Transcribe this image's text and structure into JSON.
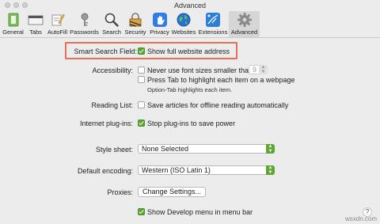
{
  "window": {
    "title": "Advanced"
  },
  "toolbar": {
    "items": [
      {
        "label": "General",
        "icon": "general-icon"
      },
      {
        "label": "Tabs",
        "icon": "tabs-icon"
      },
      {
        "label": "AutoFill",
        "icon": "autofill-icon"
      },
      {
        "label": "Passwords",
        "icon": "passwords-icon"
      },
      {
        "label": "Search",
        "icon": "search-icon"
      },
      {
        "label": "Security",
        "icon": "security-icon"
      },
      {
        "label": "Privacy",
        "icon": "privacy-icon"
      },
      {
        "label": "Websites",
        "icon": "websites-icon"
      },
      {
        "label": "Extensions",
        "icon": "extensions-icon"
      },
      {
        "label": "Advanced",
        "icon": "gear-icon",
        "selected": true
      }
    ]
  },
  "settings": {
    "smart_search": {
      "label": "Smart Search Field:",
      "option": "Show full website address",
      "checked": true
    },
    "accessibility": {
      "label": "Accessibility:",
      "option1": "Never use font sizes smaller than",
      "option1_checked": false,
      "font_size_value": "9",
      "option2": "Press Tab to highlight each item on a webpage",
      "option2_checked": false,
      "note": "Option-Tab highlights each item."
    },
    "reading_list": {
      "label": "Reading List:",
      "option": "Save articles for offline reading automatically",
      "checked": false
    },
    "plugins": {
      "label": "Internet plug-ins:",
      "option": "Stop plug-ins to save power",
      "checked": true
    },
    "style_sheet": {
      "label": "Style sheet:",
      "value": "None Selected"
    },
    "encoding": {
      "label": "Default encoding:",
      "value": "Western (ISO Latin 1)"
    },
    "proxies": {
      "label": "Proxies:",
      "button": "Change Settings..."
    },
    "develop_menu": {
      "option": "Show Develop menu in menu bar",
      "checked": true
    }
  },
  "help": {
    "label": "?"
  },
  "watermark": "wsxdn.com",
  "colors": {
    "accent": "#5ca833",
    "highlight_box": "#e87056"
  }
}
